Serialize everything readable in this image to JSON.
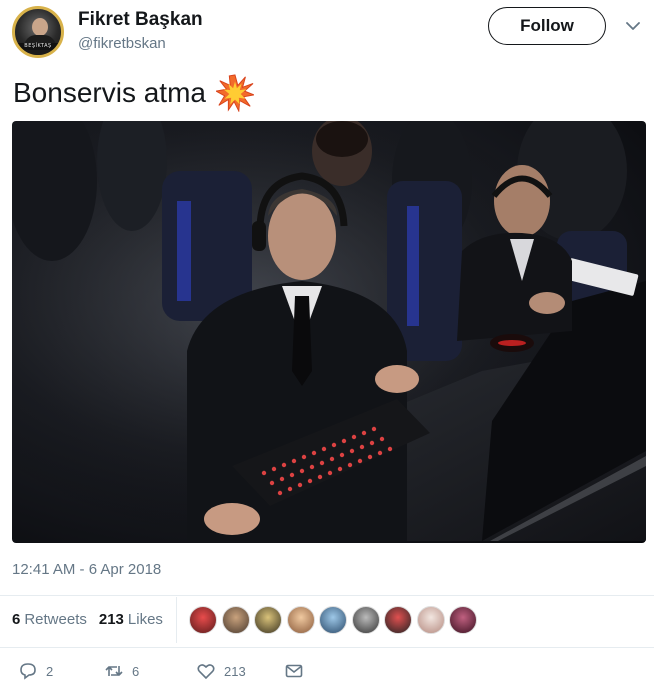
{
  "user": {
    "display_name": "Fikret Başkan",
    "handle": "@fikretbskan",
    "avatar_icon": "profile-avatar",
    "avatar_banner": "BEŞİKTAŞ"
  },
  "follow_button": {
    "label": "Follow"
  },
  "menu_icon": "chevron-down-icon",
  "tweet": {
    "text": "Bonservis atma",
    "emoji_icon": "collision-emoji-icon",
    "photo_icon": "tweet-photo"
  },
  "timestamp": "12:41 AM - 6 Apr 2018",
  "stats": {
    "retweets_count": "6",
    "retweets_label": "Retweets",
    "likes_count": "213",
    "likes_label": "Likes"
  },
  "likers_count_shown": 9,
  "actions": {
    "reply_count": "2",
    "retweet_count": "6",
    "like_count": "213"
  },
  "colors": {
    "text": "#14171a",
    "secondary": "#657786",
    "divider": "#e6ecf0",
    "avatar_ring": "#d8b24a"
  }
}
